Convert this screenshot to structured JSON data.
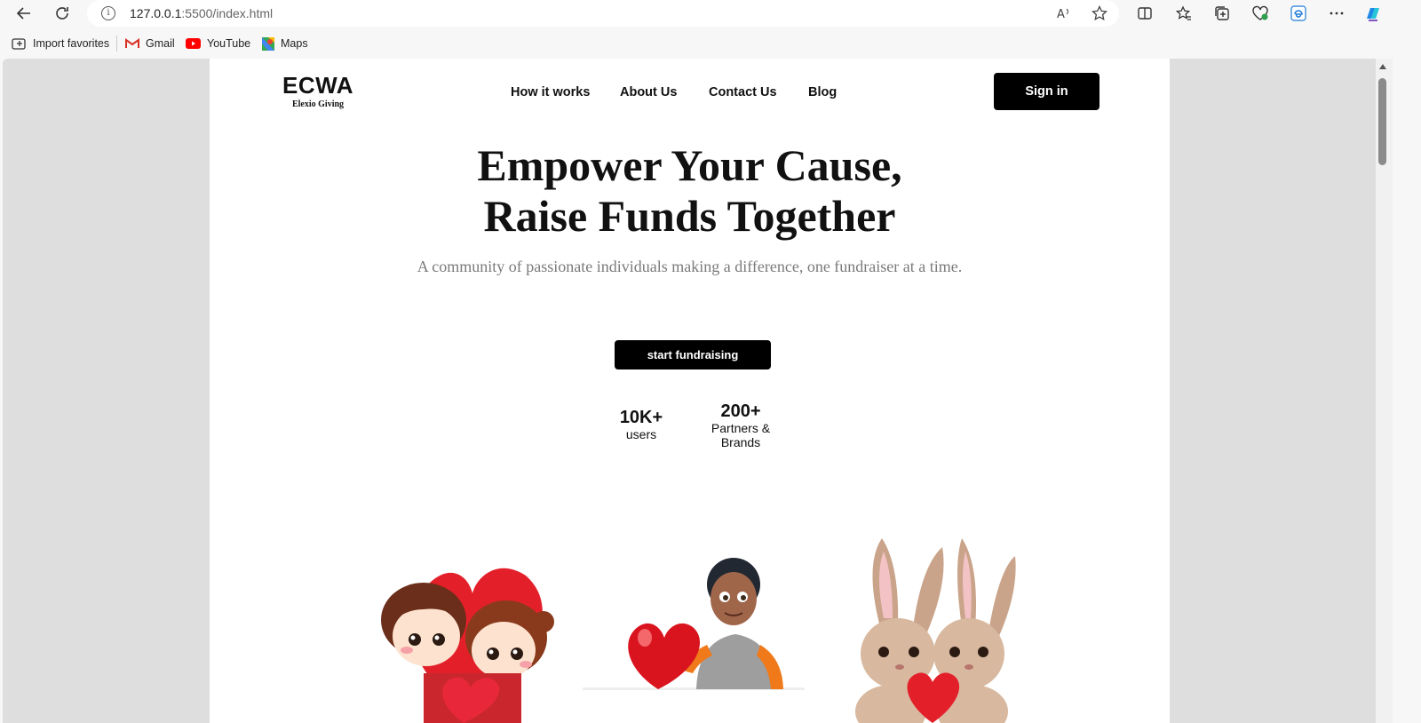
{
  "browser": {
    "url_host": "127.0.0.1",
    "url_path": ":5500/index.html",
    "favorites": [
      {
        "label": "Import favorites"
      },
      {
        "label": "Gmail"
      },
      {
        "label": "YouTube"
      },
      {
        "label": "Maps"
      }
    ]
  },
  "site": {
    "logo_title": "ECWA",
    "logo_subtitle": "Elexio Giving",
    "nav": [
      "How it works",
      "About Us",
      "Contact Us",
      "Blog"
    ],
    "signin_label": "Sign in"
  },
  "hero": {
    "title_line1": "Empower Your Cause,",
    "title_line2": "Raise Funds Together",
    "subtitle": "A community of passionate individuals making a difference, one fundraiser at a time.",
    "cta_label": "start fundraising"
  },
  "stats": [
    {
      "value": "10K+",
      "label": "users"
    },
    {
      "value": "200+",
      "label_line1": "Partners &",
      "label_line2": "Brands"
    }
  ],
  "colors": {
    "primary": "#000000",
    "heart": "#e3202a",
    "subtitle_gray": "#7a7a7a"
  }
}
